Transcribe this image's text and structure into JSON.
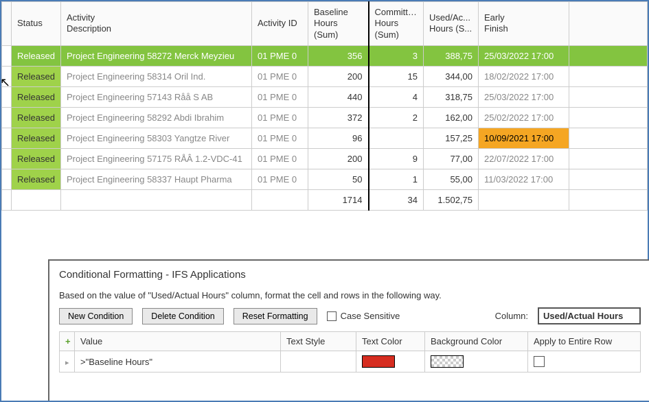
{
  "grid": {
    "headers": {
      "status": "Status",
      "activity_description": "Activity\nDescription",
      "activity_id": "Activity ID",
      "baseline_hours": "Baseline Hours (Sum)",
      "committed_hours": "Committed Hours (Sum)",
      "used_actual_hours": "Used/Ac... Hours (S...",
      "early_finish": "Early\nFinish"
    },
    "rows": [
      {
        "selected": true,
        "status": "Released",
        "desc": "Project Engineering 58272 Merck Meyzieu",
        "activity_id": "01 PME 0",
        "baseline": "356",
        "committed": "3",
        "used": "388,75",
        "early_finish": "25/03/2022 17:00",
        "early_finish_hl": false
      },
      {
        "selected": false,
        "status": "Released",
        "desc": "Project Engineering 58314 Oril Ind.",
        "activity_id": "01 PME 0",
        "baseline": "200",
        "committed": "15",
        "used": "344,00",
        "early_finish": "18/02/2022 17:00",
        "early_finish_hl": false
      },
      {
        "selected": false,
        "status": "Released",
        "desc": "Project Engineering 57143 Råå S AB",
        "activity_id": "01 PME 0",
        "baseline": "440",
        "committed": "4",
        "used": "318,75",
        "early_finish": "25/03/2022 17:00",
        "early_finish_hl": false
      },
      {
        "selected": false,
        "status": "Released",
        "desc": "Project Engineering 58292 Abdi Ibrahim",
        "activity_id": "01 PME 0",
        "baseline": "372",
        "committed": "2",
        "used": "162,00",
        "early_finish": "25/02/2022 17:00",
        "early_finish_hl": false
      },
      {
        "selected": false,
        "status": "Released",
        "desc": "Project Engineering 58303 Yangtze River",
        "activity_id": "01 PME 0",
        "baseline": "96",
        "committed": "",
        "used": "157,25",
        "early_finish": "10/09/2021 17:00",
        "early_finish_hl": true
      },
      {
        "selected": false,
        "status": "Released",
        "desc": "Project Engineering 57175 RÅÂ 1.2-VDC-41",
        "activity_id": "01 PME 0",
        "baseline": "200",
        "committed": "9",
        "used": "77,00",
        "early_finish": "22/07/2022 17:00",
        "early_finish_hl": false
      },
      {
        "selected": false,
        "status": "Released",
        "desc": "Project Engineering 58337 Haupt Pharma",
        "activity_id": "01 PME 0",
        "baseline": "50",
        "committed": "1",
        "used": "55,00",
        "early_finish": "11/03/2022 17:00",
        "early_finish_hl": false
      }
    ],
    "footer": {
      "baseline": "1714",
      "committed": "34",
      "used": "1.502,75"
    }
  },
  "cf": {
    "title": "Conditional Formatting - IFS Applications",
    "desc": "Based on the value of \"Used/Actual Hours\" column, format the cell and rows in the following way.",
    "buttons": {
      "new": "New Condition",
      "delete": "Delete Condition",
      "reset": "Reset Formatting"
    },
    "case_sensitive_label": "Case Sensitive",
    "column_label": "Column:",
    "column_value": "Used/Actual Hours",
    "headers": {
      "value": "Value",
      "text_style": "Text Style",
      "text_color": "Text Color",
      "background_color": "Background Color",
      "apply_row": "Apply to Entire Row"
    },
    "condition": {
      "value": ">\"Baseline Hours\""
    }
  }
}
